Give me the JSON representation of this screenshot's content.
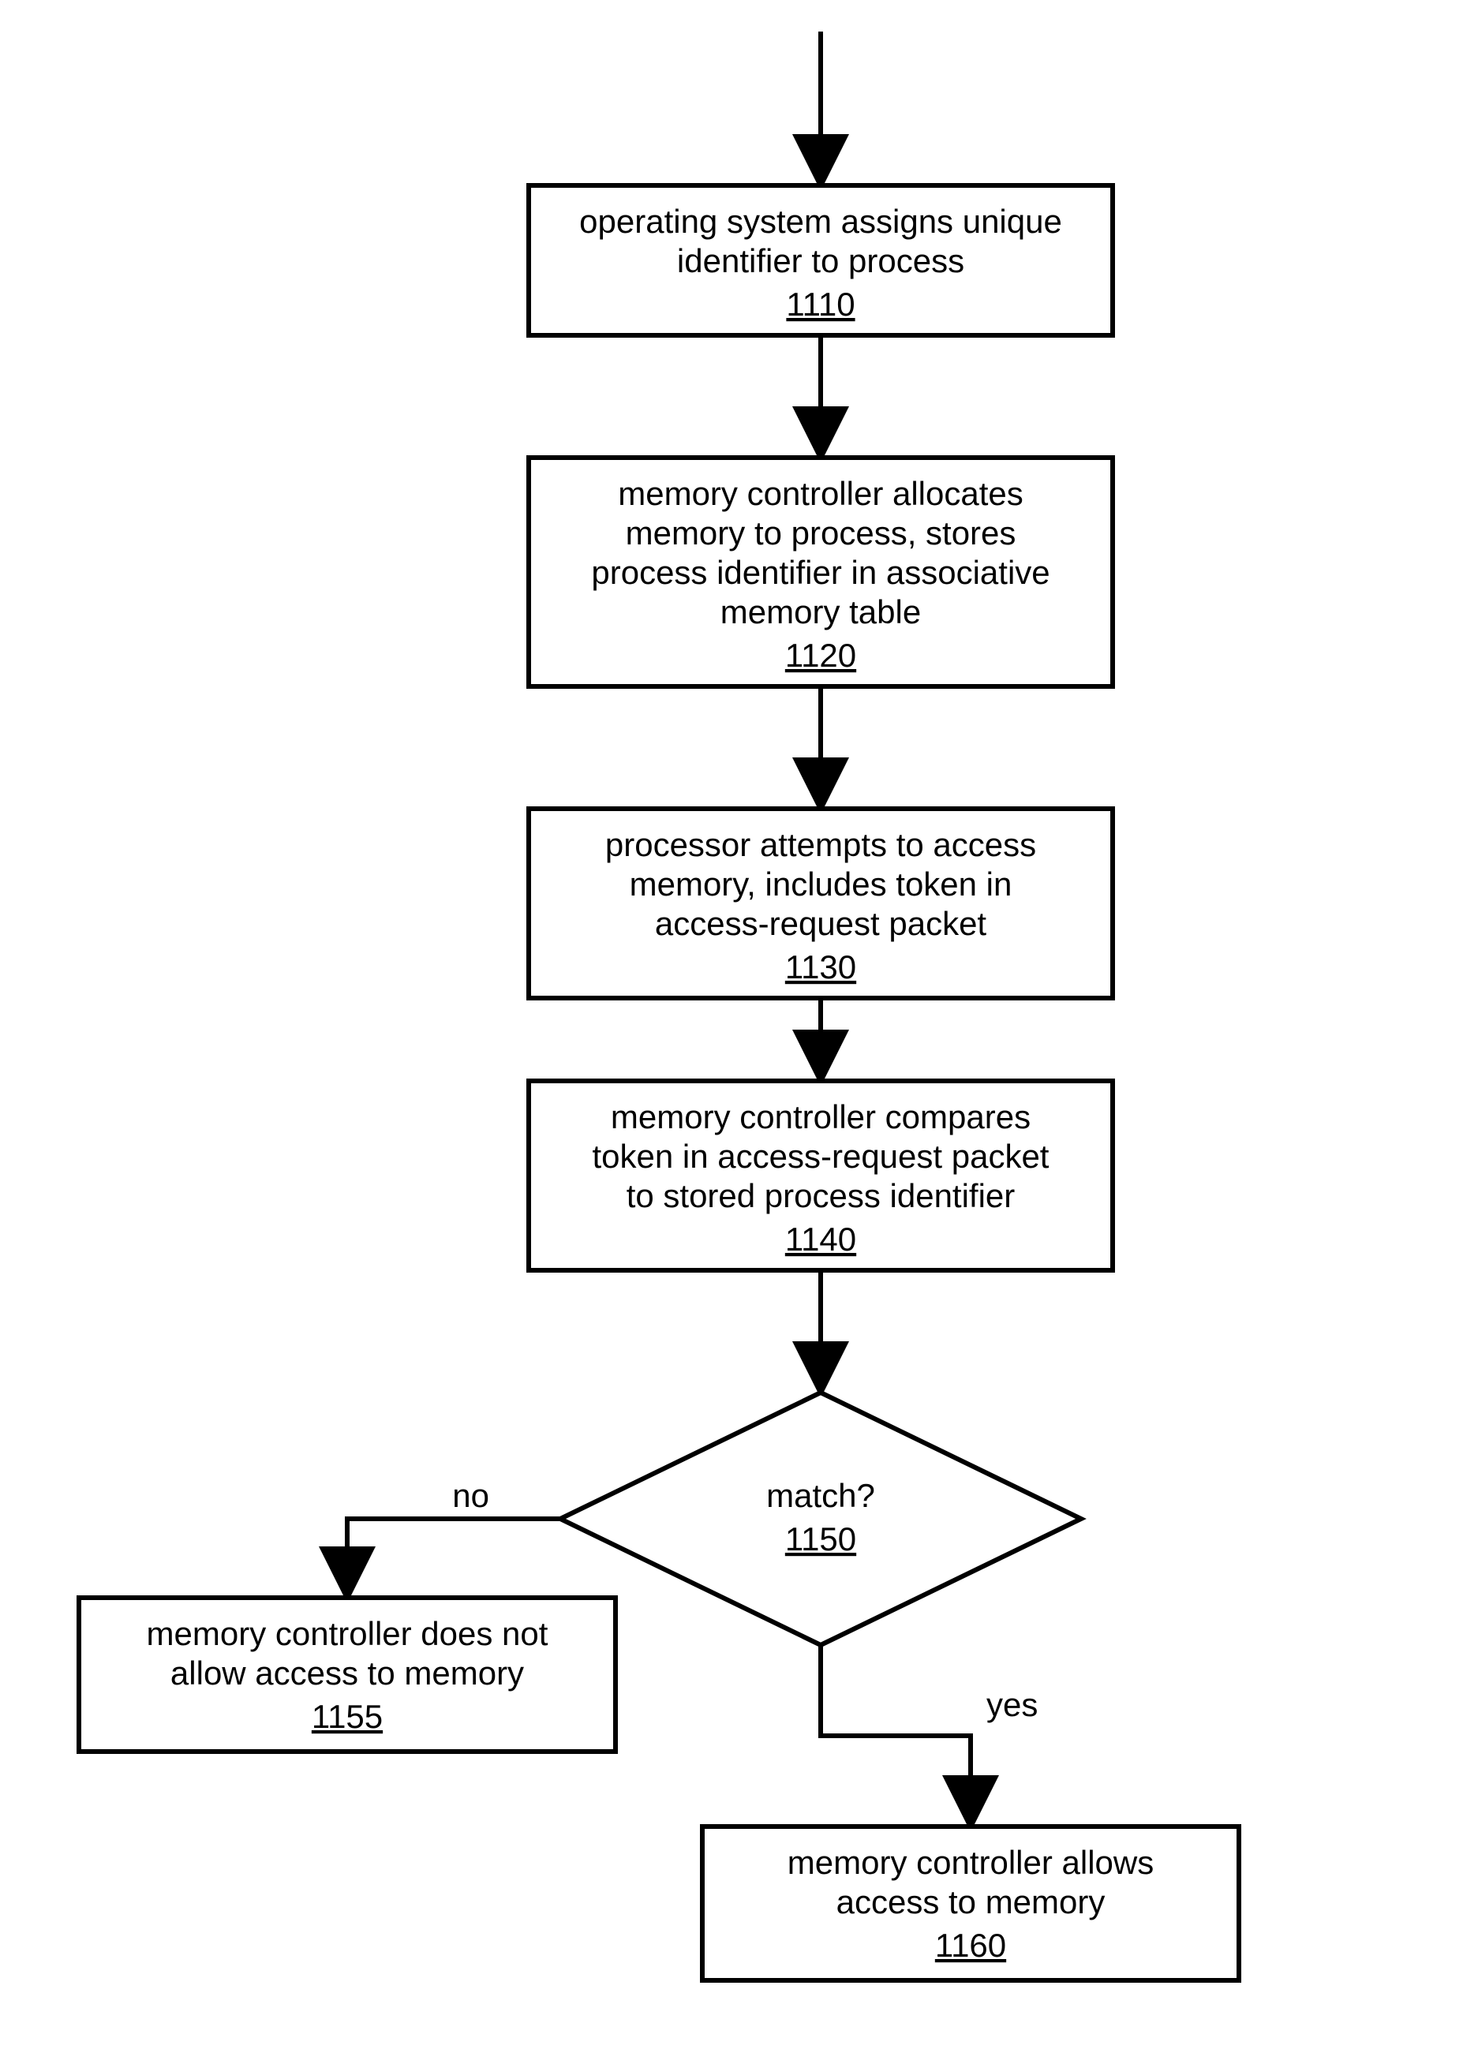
{
  "chart_data": {
    "type": "flowchart",
    "nodes": [
      {
        "id": "1110",
        "ref": "1110",
        "lines": [
          "operating system assigns unique",
          "identifier to process"
        ]
      },
      {
        "id": "1120",
        "ref": "1120",
        "lines": [
          "memory controller allocates",
          "memory to process, stores",
          "process identifier in associative",
          "memory table"
        ]
      },
      {
        "id": "1130",
        "ref": "1130",
        "lines": [
          "processor attempts to access",
          "memory, includes token in",
          "access-request packet"
        ]
      },
      {
        "id": "1140",
        "ref": "1140",
        "lines": [
          "memory controller compares",
          "token in access-request packet",
          "to stored process identifier"
        ]
      },
      {
        "id": "1150",
        "ref": "1150",
        "lines": [
          "match?"
        ],
        "shape": "decision"
      },
      {
        "id": "1155",
        "ref": "1155",
        "lines": [
          "memory controller does not",
          "allow access to memory"
        ]
      },
      {
        "id": "1160",
        "ref": "1160",
        "lines": [
          "memory controller allows",
          "access to memory"
        ]
      }
    ],
    "edges": [
      {
        "from": "start",
        "to": "1110"
      },
      {
        "from": "1110",
        "to": "1120"
      },
      {
        "from": "1120",
        "to": "1130"
      },
      {
        "from": "1130",
        "to": "1140"
      },
      {
        "from": "1140",
        "to": "1150"
      },
      {
        "from": "1150",
        "to": "1155",
        "label": "no"
      },
      {
        "from": "1150",
        "to": "1160",
        "label": "yes"
      }
    ],
    "labels": {
      "no": "no",
      "yes": "yes"
    }
  }
}
